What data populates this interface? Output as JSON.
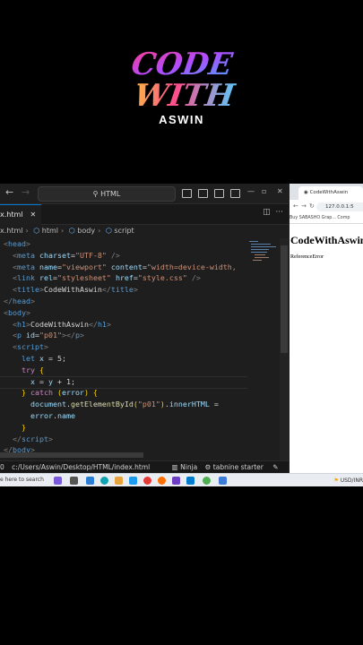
{
  "brand": {
    "line1": "CODE",
    "line2": "WITH",
    "name": "ASWIN"
  },
  "vscode": {
    "search_text": "HTML",
    "tab_label": "x.html",
    "breadcrumbs": [
      "x.html",
      "html",
      "body",
      "script"
    ],
    "code_lines": [
      [
        {
          "t": "<",
          "c": "t"
        },
        {
          "t": "head",
          "c": "n"
        },
        {
          "t": ">",
          "c": "t"
        }
      ],
      [
        {
          "t": "  <",
          "c": "t"
        },
        {
          "t": "meta ",
          "c": "n"
        },
        {
          "t": "charset",
          "c": "a"
        },
        {
          "t": "=",
          "c": "tx"
        },
        {
          "t": "\"UTF-8\"",
          "c": "s"
        },
        {
          "t": " />",
          "c": "t"
        }
      ],
      [
        {
          "t": "  <",
          "c": "t"
        },
        {
          "t": "meta ",
          "c": "n"
        },
        {
          "t": "name",
          "c": "a"
        },
        {
          "t": "=",
          "c": "tx"
        },
        {
          "t": "\"viewport\"",
          "c": "s"
        },
        {
          "t": " ",
          "c": "tx"
        },
        {
          "t": "content",
          "c": "a"
        },
        {
          "t": "=",
          "c": "tx"
        },
        {
          "t": "\"width=device-width,",
          "c": "s"
        }
      ],
      [
        {
          "t": "  <",
          "c": "t"
        },
        {
          "t": "link ",
          "c": "n"
        },
        {
          "t": "rel",
          "c": "a"
        },
        {
          "t": "=",
          "c": "tx"
        },
        {
          "t": "\"stylesheet\"",
          "c": "s"
        },
        {
          "t": " ",
          "c": "tx"
        },
        {
          "t": "href",
          "c": "a"
        },
        {
          "t": "=",
          "c": "tx"
        },
        {
          "t": "\"style.css\"",
          "c": "s"
        },
        {
          "t": " />",
          "c": "t"
        }
      ],
      [
        {
          "t": "  <",
          "c": "t"
        },
        {
          "t": "title",
          "c": "n"
        },
        {
          "t": ">",
          "c": "t"
        },
        {
          "t": "CodeWithAswin",
          "c": "tx"
        },
        {
          "t": "</",
          "c": "t"
        },
        {
          "t": "title",
          "c": "n"
        },
        {
          "t": ">",
          "c": "t"
        }
      ],
      [
        {
          "t": "</",
          "c": "t"
        },
        {
          "t": "head",
          "c": "n"
        },
        {
          "t": ">",
          "c": "t"
        }
      ],
      [
        {
          "t": "<",
          "c": "t"
        },
        {
          "t": "body",
          "c": "n"
        },
        {
          "t": ">",
          "c": "t"
        }
      ],
      [
        {
          "t": "  <",
          "c": "t"
        },
        {
          "t": "h1",
          "c": "n"
        },
        {
          "t": ">",
          "c": "t"
        },
        {
          "t": "CodeWithAswin",
          "c": "tx"
        },
        {
          "t": "</",
          "c": "t"
        },
        {
          "t": "h1",
          "c": "n"
        },
        {
          "t": ">",
          "c": "t"
        }
      ],
      [
        {
          "t": "  <",
          "c": "t"
        },
        {
          "t": "p ",
          "c": "n"
        },
        {
          "t": "id",
          "c": "a"
        },
        {
          "t": "=",
          "c": "tx"
        },
        {
          "t": "\"p01\"",
          "c": "s"
        },
        {
          "t": "></",
          "c": "t"
        },
        {
          "t": "p",
          "c": "n"
        },
        {
          "t": ">",
          "c": "t"
        }
      ],
      [
        {
          "t": "  <",
          "c": "t"
        },
        {
          "t": "script",
          "c": "n"
        },
        {
          "t": ">",
          "c": "t"
        }
      ],
      [
        {
          "t": "    ",
          "c": "tx"
        },
        {
          "t": "let ",
          "c": "kw"
        },
        {
          "t": "x",
          "c": "v"
        },
        {
          "t": " = ",
          "c": "tx"
        },
        {
          "t": "5",
          "c": "tx"
        },
        {
          "t": ";",
          "c": "tx"
        }
      ],
      [
        {
          "t": "    ",
          "c": "tx"
        },
        {
          "t": "try ",
          "c": "k"
        },
        {
          "t": "{",
          "c": "b"
        }
      ],
      [
        {
          "t": "      ",
          "c": "tx"
        },
        {
          "t": "x",
          "c": "v"
        },
        {
          "t": " = ",
          "c": "tx"
        },
        {
          "t": "y",
          "c": "v"
        },
        {
          "t": " + ",
          "c": "tx"
        },
        {
          "t": "1",
          "c": "tx"
        },
        {
          "t": ";",
          "c": "tx"
        }
      ],
      [
        {
          "t": "    ",
          "c": "tx"
        },
        {
          "t": "}",
          "c": "b"
        },
        {
          "t": " catch ",
          "c": "k"
        },
        {
          "t": "(",
          "c": "b"
        },
        {
          "t": "error",
          "c": "v"
        },
        {
          "t": ") {",
          "c": "b"
        }
      ],
      [
        {
          "t": "      ",
          "c": "tx"
        },
        {
          "t": "document",
          "c": "v"
        },
        {
          "t": ".",
          "c": "tx"
        },
        {
          "t": "getElementById",
          "c": "f"
        },
        {
          "t": "(",
          "c": "b"
        },
        {
          "t": "\"p01\"",
          "c": "s"
        },
        {
          "t": ")",
          "c": "b"
        },
        {
          "t": ".",
          "c": "tx"
        },
        {
          "t": "innerHTML",
          "c": "v"
        },
        {
          "t": " =",
          "c": "tx"
        }
      ],
      [
        {
          "t": "      ",
          "c": "tx"
        },
        {
          "t": "error",
          "c": "v"
        },
        {
          "t": ".",
          "c": "tx"
        },
        {
          "t": "name",
          "c": "v"
        }
      ],
      [
        {
          "t": "    ",
          "c": "tx"
        },
        {
          "t": "}",
          "c": "b"
        }
      ],
      [
        {
          "t": "  </",
          "c": "t"
        },
        {
          "t": "script",
          "c": "n"
        },
        {
          "t": ">",
          "c": "t"
        }
      ],
      [
        {
          "t": "</",
          "c": "t"
        },
        {
          "t": "body",
          "c": "n"
        },
        {
          "t": ">",
          "c": "t"
        }
      ]
    ],
    "status_path": "c:/Users/Aswin/Desktop/HTML/index.html",
    "status_ninja": "Ninja",
    "status_tabnine": "tabnine starter",
    "status_errors": "0"
  },
  "browser": {
    "tab_title": "CodeWithAswin",
    "url": "127.0.0.1:5",
    "bookmarks": "Buy SABASHO Grap...   Comp",
    "page_h1": "CodeWithAswin",
    "page_p": "ReferenceError"
  },
  "taskbar": {
    "search": "e here to search",
    "tray_text": "USD/INR"
  },
  "colors": {
    "vscode_bg": "#1e1e1e",
    "accent": "#0078d4"
  }
}
